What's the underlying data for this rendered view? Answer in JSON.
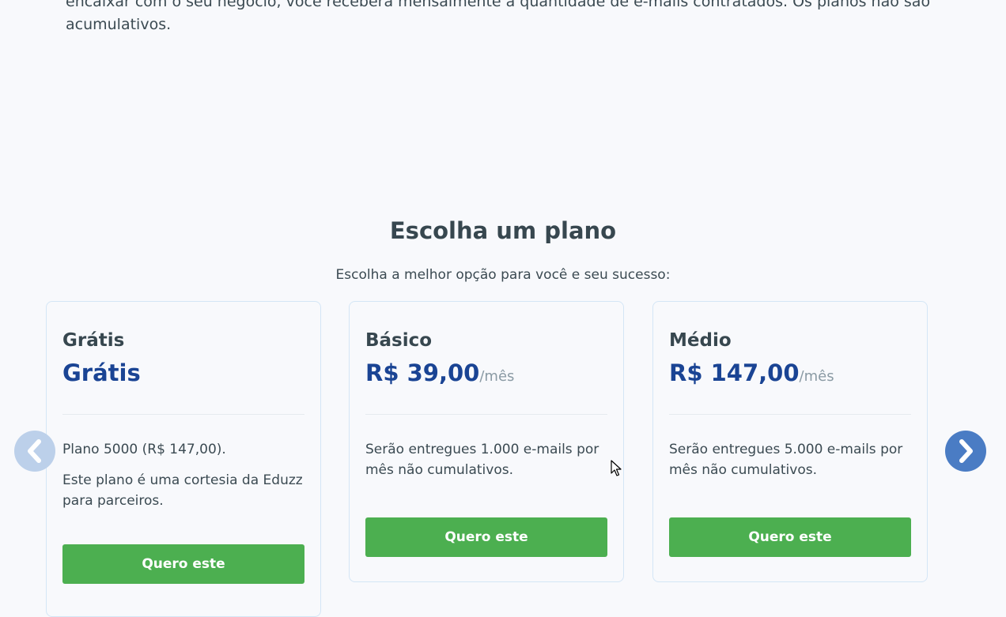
{
  "intro": {
    "text": "encaixar com o seu negócio, você receberá mensalmente a quantidade de e-mails contratados. Os planos não são acumulativos."
  },
  "section": {
    "title": "Escolha um plano",
    "subtitle": "Escolha a melhor opção para você e seu sucesso:"
  },
  "plans": [
    {
      "name": "Grátis",
      "price": "Grátis",
      "period": "",
      "descriptions": [
        "Plano 5000 (R$ 147,00).",
        "Este plano é uma cortesia da Eduzz para parceiros."
      ],
      "button_label": "Quero este"
    },
    {
      "name": "Básico",
      "price": "R$ 39,00",
      "period": "/mês",
      "descriptions": [
        "Serão entregues 1.000 e-mails por mês não cumulativos."
      ],
      "button_label": "Quero este"
    },
    {
      "name": "Médio",
      "price": "R$ 147,00",
      "period": "/mês",
      "descriptions": [
        "Serão entregues 5.000 e-mails por mês não cumulativos."
      ],
      "button_label": "Quero este"
    }
  ],
  "carousel": {
    "prev_icon": "chevron-left-icon",
    "next_icon": "chevron-right-icon"
  },
  "colors": {
    "price": "#1a4494",
    "button": "#4caf50",
    "nav_active": "#4a7cc4",
    "nav_disabled": "#bcd0ea"
  }
}
